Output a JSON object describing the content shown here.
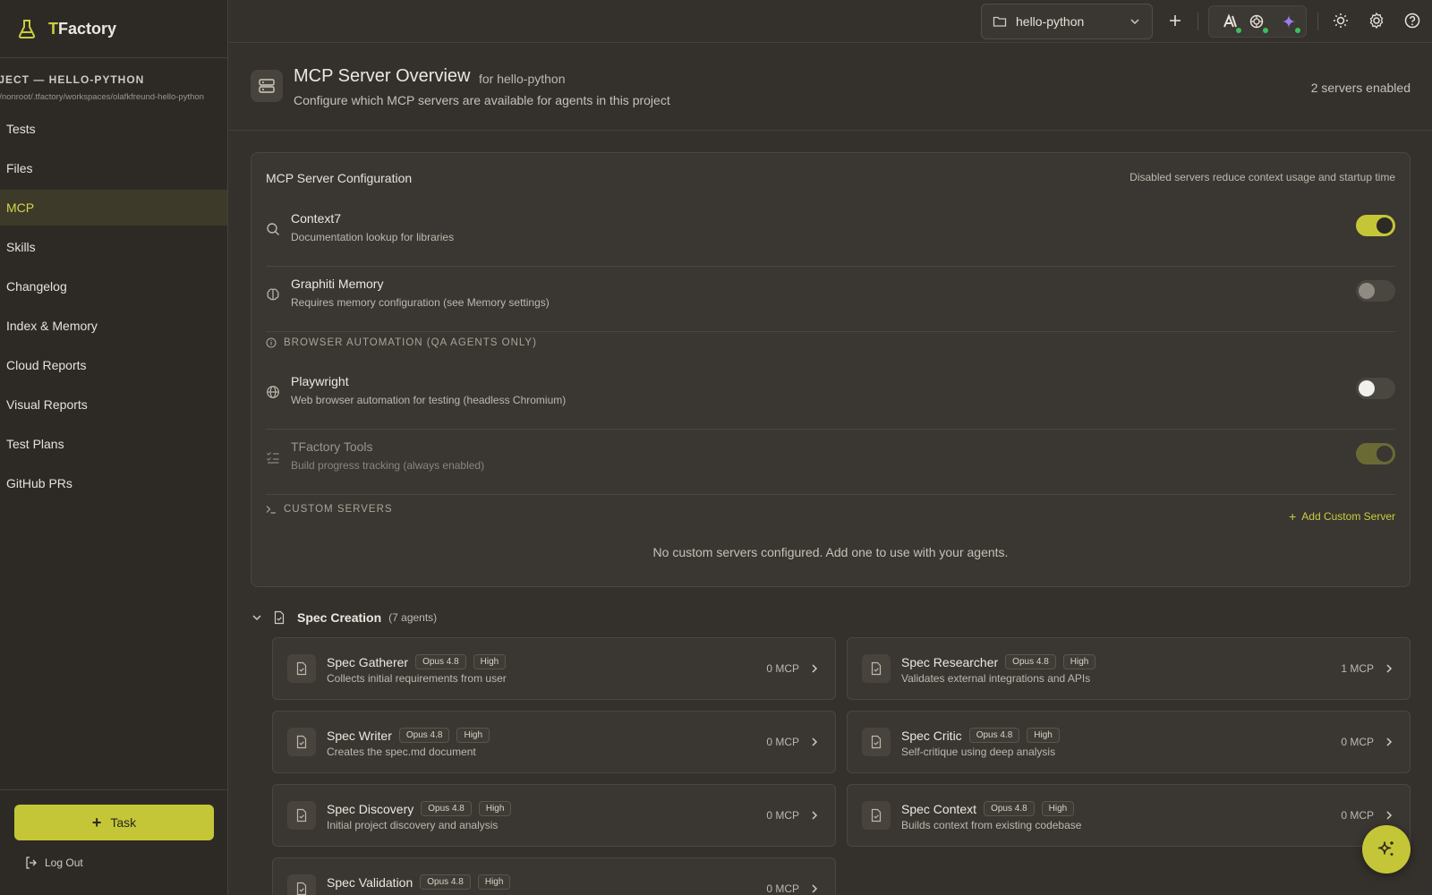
{
  "app": {
    "brand_prefix": "T",
    "brand_suffix": "Factory"
  },
  "project": {
    "title": "OJECT — HELLO-PYTHON",
    "path": "e/nonroot/.tfactory/workspaces/olafkfreund-hello-python"
  },
  "nav": [
    "Tests",
    "Files",
    "MCP",
    "Skills",
    "Changelog",
    "Index & Memory",
    "Cloud Reports",
    "Visual Reports",
    "Test Plans",
    "GitHub PRs"
  ],
  "nav_active": "MCP",
  "sidebar_bottom": {
    "task_label": "Task",
    "logout_label": "Log Out"
  },
  "topbar": {
    "project_select": "hello-python"
  },
  "colors": {
    "accent": "#c4c637",
    "status_online": "#3fbf5a"
  },
  "header": {
    "title": "MCP Server Overview",
    "for": "for hello-python",
    "subtitle": "Configure which MCP servers are available for agents in this project",
    "count": "2 servers enabled"
  },
  "config": {
    "title": "MCP Server Configuration",
    "note": "Disabled servers reduce context usage and startup time",
    "servers": [
      {
        "name": "Context7",
        "desc": "Documentation lookup for libraries",
        "icon": "search-icon",
        "enabled": true
      },
      {
        "name": "Graphiti Memory",
        "desc": "Requires memory configuration (see Memory settings)",
        "icon": "brain-icon",
        "enabled": false
      }
    ],
    "browser_label": "BROWSER AUTOMATION (QA AGENTS ONLY)",
    "browser_servers": [
      {
        "name": "Playwright",
        "desc": "Web browser automation for testing (headless Chromium)",
        "icon": "globe-icon",
        "enabled": false
      }
    ],
    "builtin": {
      "name": "TFactory Tools",
      "desc": "Build progress tracking (always enabled)",
      "icon": "checklist-icon",
      "enabled": true
    },
    "custom_label": "CUSTOM SERVERS",
    "add_custom": "Add Custom Server",
    "empty": "No custom servers configured. Add one to use with your agents."
  },
  "group": {
    "title": "Spec Creation",
    "count": "(7 agents)",
    "agents": [
      {
        "name": "Spec Gatherer",
        "model": "Opus 4.8",
        "effort": "High",
        "desc": "Collects initial requirements from user",
        "mcp": "0 MCP"
      },
      {
        "name": "Spec Researcher",
        "model": "Opus 4.8",
        "effort": "High",
        "desc": "Validates external integrations and APIs",
        "mcp": "1 MCP"
      },
      {
        "name": "Spec Writer",
        "model": "Opus 4.8",
        "effort": "High",
        "desc": "Creates the spec.md document",
        "mcp": "0 MCP"
      },
      {
        "name": "Spec Critic",
        "model": "Opus 4.8",
        "effort": "High",
        "desc": "Self-critique using deep analysis",
        "mcp": "0 MCP"
      },
      {
        "name": "Spec Discovery",
        "model": "Opus 4.8",
        "effort": "High",
        "desc": "Initial project discovery and analysis",
        "mcp": "0 MCP"
      },
      {
        "name": "Spec Context",
        "model": "Opus 4.8",
        "effort": "High",
        "desc": "Builds context from existing codebase",
        "mcp": "0 MCP"
      },
      {
        "name": "Spec Validation",
        "model": "Opus 4.8",
        "effort": "High",
        "desc": "",
        "mcp": "0 MCP"
      }
    ]
  }
}
